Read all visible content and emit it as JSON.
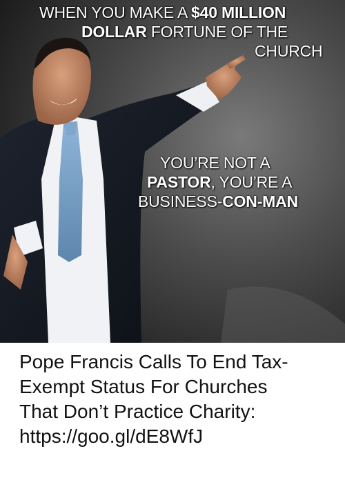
{
  "meme": {
    "top_caption": {
      "line1_pre": "WHEN YOU MAKE A ",
      "line1_bold": "$40 MILLION",
      "line2_bold": "DOLLAR",
      "line2_post": " FORTUNE OF  THE",
      "line3": "CHURCH"
    },
    "bottom_caption": {
      "line1": "YOU’RE NOT A",
      "line2_bold": "PASTOR",
      "line2_post": ", YOU’RE A",
      "line3_pre": "BUSINESS-",
      "line3_bold": "CON-MAN"
    }
  },
  "post": {
    "lines": [
      "Pope Francis Calls To End Tax-",
      "Exempt Status For Churches",
      "That Don’t Practice Charity:",
      "https://goo.gl/dE8WfJ"
    ]
  }
}
